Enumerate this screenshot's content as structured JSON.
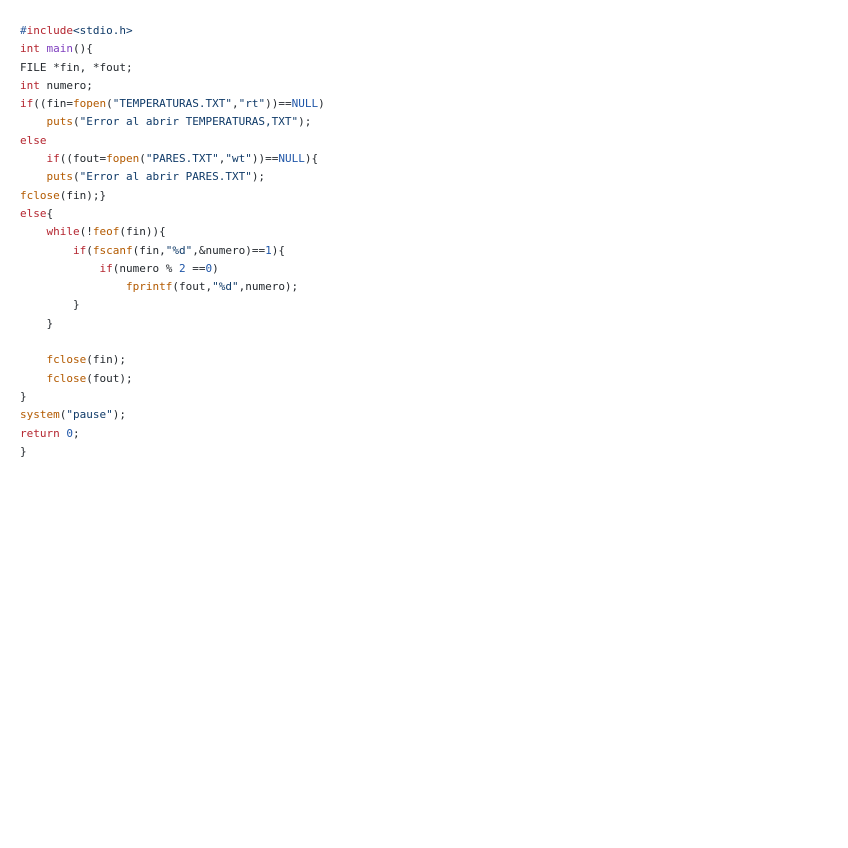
{
  "code": {
    "language": "c",
    "lines": [
      [
        {
          "t": "pp",
          "v": "#"
        },
        {
          "t": "ppkw",
          "v": "include"
        },
        {
          "t": "inc",
          "v": "<stdio.h>"
        }
      ],
      [
        {
          "t": "type",
          "v": "int"
        },
        {
          "t": "plain",
          "v": " "
        },
        {
          "t": "fnname",
          "v": "main"
        },
        {
          "t": "plain",
          "v": "(){"
        }
      ],
      [
        {
          "t": "plain",
          "v": "FILE *fin, *fout;"
        }
      ],
      [
        {
          "t": "type",
          "v": "int"
        },
        {
          "t": "plain",
          "v": " numero;"
        }
      ],
      [
        {
          "t": "kw",
          "v": "if"
        },
        {
          "t": "plain",
          "v": "((fin="
        },
        {
          "t": "fn",
          "v": "fopen"
        },
        {
          "t": "plain",
          "v": "("
        },
        {
          "t": "str",
          "v": "\"TEMPERATURAS.TXT\""
        },
        {
          "t": "plain",
          "v": ","
        },
        {
          "t": "str",
          "v": "\"rt\""
        },
        {
          "t": "plain",
          "v": "))=="
        },
        {
          "t": "const",
          "v": "NULL"
        },
        {
          "t": "plain",
          "v": ")"
        }
      ],
      [
        {
          "t": "plain",
          "v": "    "
        },
        {
          "t": "fn",
          "v": "puts"
        },
        {
          "t": "plain",
          "v": "("
        },
        {
          "t": "str",
          "v": "\"Error al abrir TEMPERATURAS,TXT\""
        },
        {
          "t": "plain",
          "v": ");"
        }
      ],
      [
        {
          "t": "kw",
          "v": "else"
        }
      ],
      [
        {
          "t": "plain",
          "v": "    "
        },
        {
          "t": "kw",
          "v": "if"
        },
        {
          "t": "plain",
          "v": "((fout="
        },
        {
          "t": "fn",
          "v": "fopen"
        },
        {
          "t": "plain",
          "v": "("
        },
        {
          "t": "str",
          "v": "\"PARES.TXT\""
        },
        {
          "t": "plain",
          "v": ","
        },
        {
          "t": "str",
          "v": "\"wt\""
        },
        {
          "t": "plain",
          "v": "))=="
        },
        {
          "t": "const",
          "v": "NULL"
        },
        {
          "t": "plain",
          "v": "){"
        }
      ],
      [
        {
          "t": "plain",
          "v": "    "
        },
        {
          "t": "fn",
          "v": "puts"
        },
        {
          "t": "plain",
          "v": "("
        },
        {
          "t": "str",
          "v": "\"Error al abrir PARES.TXT\""
        },
        {
          "t": "plain",
          "v": ");"
        }
      ],
      [
        {
          "t": "fn",
          "v": "fclose"
        },
        {
          "t": "plain",
          "v": "(fin);}"
        }
      ],
      [
        {
          "t": "kw",
          "v": "else"
        },
        {
          "t": "plain",
          "v": "{"
        }
      ],
      [
        {
          "t": "plain",
          "v": "    "
        },
        {
          "t": "kw",
          "v": "while"
        },
        {
          "t": "plain",
          "v": "(!"
        },
        {
          "t": "fn",
          "v": "feof"
        },
        {
          "t": "plain",
          "v": "(fin)){"
        }
      ],
      [
        {
          "t": "plain",
          "v": "        "
        },
        {
          "t": "kw",
          "v": "if"
        },
        {
          "t": "plain",
          "v": "("
        },
        {
          "t": "fn",
          "v": "fscanf"
        },
        {
          "t": "plain",
          "v": "(fin,"
        },
        {
          "t": "str",
          "v": "\"%d\""
        },
        {
          "t": "plain",
          "v": ",&numero)=="
        },
        {
          "t": "num",
          "v": "1"
        },
        {
          "t": "plain",
          "v": "){"
        }
      ],
      [
        {
          "t": "plain",
          "v": "            "
        },
        {
          "t": "kw",
          "v": "if"
        },
        {
          "t": "plain",
          "v": "(numero % "
        },
        {
          "t": "num",
          "v": "2"
        },
        {
          "t": "plain",
          "v": " =="
        },
        {
          "t": "num",
          "v": "0"
        },
        {
          "t": "plain",
          "v": ")"
        }
      ],
      [
        {
          "t": "plain",
          "v": "                "
        },
        {
          "t": "fn",
          "v": "fprintf"
        },
        {
          "t": "plain",
          "v": "(fout,"
        },
        {
          "t": "str",
          "v": "\"%d\""
        },
        {
          "t": "plain",
          "v": ",numero);"
        }
      ],
      [
        {
          "t": "plain",
          "v": "        }"
        }
      ],
      [
        {
          "t": "plain",
          "v": "    }"
        }
      ],
      [],
      [
        {
          "t": "plain",
          "v": "    "
        },
        {
          "t": "fn",
          "v": "fclose"
        },
        {
          "t": "plain",
          "v": "(fin);"
        }
      ],
      [
        {
          "t": "plain",
          "v": "    "
        },
        {
          "t": "fn",
          "v": "fclose"
        },
        {
          "t": "plain",
          "v": "(fout);"
        }
      ],
      [
        {
          "t": "plain",
          "v": "}"
        }
      ],
      [
        {
          "t": "fn",
          "v": "system"
        },
        {
          "t": "plain",
          "v": "("
        },
        {
          "t": "str",
          "v": "\"pause\""
        },
        {
          "t": "plain",
          "v": ");"
        }
      ],
      [
        {
          "t": "kw",
          "v": "return"
        },
        {
          "t": "plain",
          "v": " "
        },
        {
          "t": "num",
          "v": "0"
        },
        {
          "t": "plain",
          "v": ";"
        }
      ],
      [
        {
          "t": "plain",
          "v": "}"
        }
      ]
    ]
  },
  "colors": {
    "background": "#ffffff",
    "keyword": "#b4252f",
    "function": "#b35a00",
    "function_name": "#7f3fbf",
    "string": "#0f3a68",
    "constant": "#1f56a8",
    "preprocessor": "#2f5c9e",
    "text": "#24292e"
  }
}
